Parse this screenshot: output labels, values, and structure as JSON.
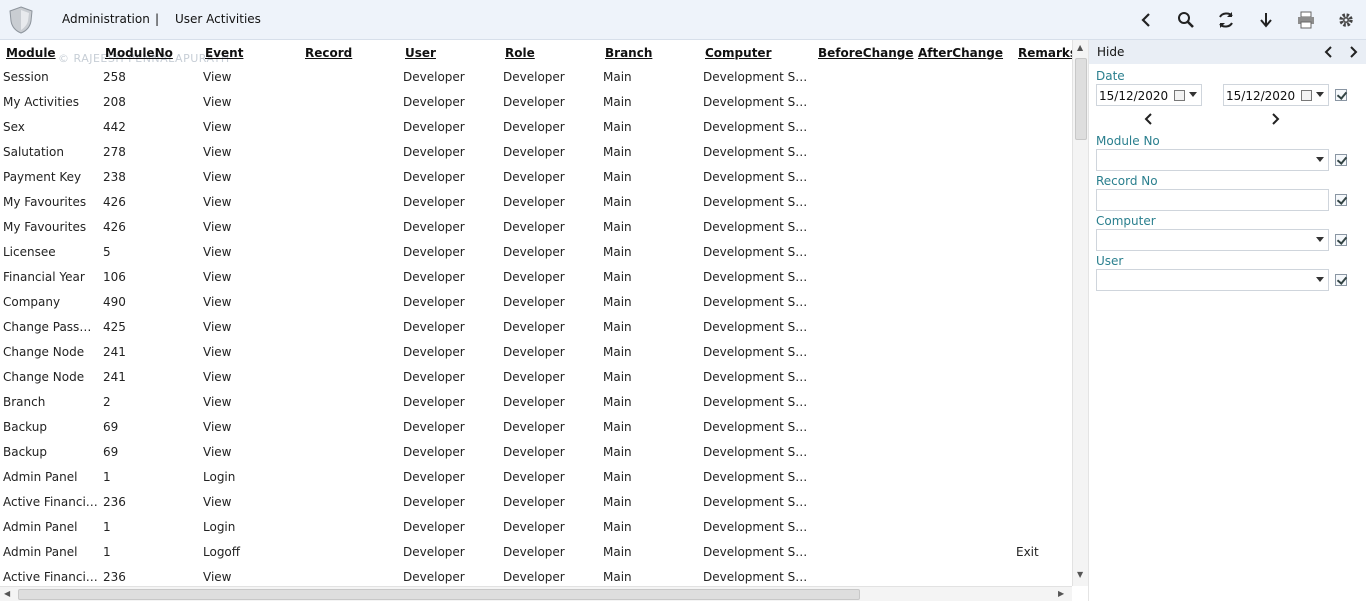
{
  "header": {
    "breadcrumb": [
      "Administration",
      "|",
      "User Activities"
    ],
    "toolbar": [
      "back-icon",
      "search-icon",
      "refresh-icon",
      "download-icon",
      "print-icon",
      "gear-icon"
    ]
  },
  "watermark": "© RAJEESH PENNALAPURATH",
  "grid": {
    "columns": [
      "Module",
      "ModuleNo",
      "Event",
      "Record",
      "User",
      "Role",
      "Branch",
      "Computer",
      "BeforeChange",
      "AfterChange",
      "Remarks"
    ],
    "rows": [
      [
        "Session",
        "258",
        "View",
        "",
        "Developer",
        "Developer",
        "Main",
        "Development Server",
        "",
        "",
        ""
      ],
      [
        "My Activities",
        "208",
        "View",
        "",
        "Developer",
        "Developer",
        "Main",
        "Development Server",
        "",
        "",
        ""
      ],
      [
        "Sex",
        "442",
        "View",
        "",
        "Developer",
        "Developer",
        "Main",
        "Development Server",
        "",
        "",
        ""
      ],
      [
        "Salutation",
        "278",
        "View",
        "",
        "Developer",
        "Developer",
        "Main",
        "Development Server",
        "",
        "",
        ""
      ],
      [
        "Payment Key",
        "238",
        "View",
        "",
        "Developer",
        "Developer",
        "Main",
        "Development Server",
        "",
        "",
        ""
      ],
      [
        "My Favourites",
        "426",
        "View",
        "",
        "Developer",
        "Developer",
        "Main",
        "Development Server",
        "",
        "",
        ""
      ],
      [
        "My Favourites",
        "426",
        "View",
        "",
        "Developer",
        "Developer",
        "Main",
        "Development Server",
        "",
        "",
        ""
      ],
      [
        "Licensee",
        "5",
        "View",
        "",
        "Developer",
        "Developer",
        "Main",
        "Development Server",
        "",
        "",
        ""
      ],
      [
        "Financial Year",
        "106",
        "View",
        "",
        "Developer",
        "Developer",
        "Main",
        "Development Server",
        "",
        "",
        ""
      ],
      [
        "Company",
        "490",
        "View",
        "",
        "Developer",
        "Developer",
        "Main",
        "Development Server",
        "",
        "",
        ""
      ],
      [
        "Change Passwo...",
        "425",
        "View",
        "",
        "Developer",
        "Developer",
        "Main",
        "Development Server",
        "",
        "",
        ""
      ],
      [
        "Change Node",
        "241",
        "View",
        "",
        "Developer",
        "Developer",
        "Main",
        "Development Server",
        "",
        "",
        ""
      ],
      [
        "Change Node",
        "241",
        "View",
        "",
        "Developer",
        "Developer",
        "Main",
        "Development Server",
        "",
        "",
        ""
      ],
      [
        "Branch",
        "2",
        "View",
        "",
        "Developer",
        "Developer",
        "Main",
        "Development Server",
        "",
        "",
        ""
      ],
      [
        "Backup",
        "69",
        "View",
        "",
        "Developer",
        "Developer",
        "Main",
        "Development Server",
        "",
        "",
        ""
      ],
      [
        "Backup",
        "69",
        "View",
        "",
        "Developer",
        "Developer",
        "Main",
        "Development Server",
        "",
        "",
        ""
      ],
      [
        "Admin Panel",
        "1",
        "Login",
        "",
        "Developer",
        "Developer",
        "Main",
        "Development Server",
        "",
        "",
        ""
      ],
      [
        "Active Financial...",
        "236",
        "View",
        "",
        "Developer",
        "Developer",
        "Main",
        "Development Server",
        "",
        "",
        ""
      ],
      [
        "Admin Panel",
        "1",
        "Login",
        "",
        "Developer",
        "Developer",
        "Main",
        "Development Server",
        "",
        "",
        ""
      ],
      [
        "Admin Panel",
        "1",
        "Logoff",
        "",
        "Developer",
        "Developer",
        "Main",
        "Development Server",
        "",
        "",
        "Exit"
      ],
      [
        "Active Financial...",
        "236",
        "View",
        "",
        "Developer",
        "Developer",
        "Main",
        "Development Server",
        "",
        "",
        ""
      ]
    ]
  },
  "filter_panel": {
    "hide_label": "Hide",
    "date_label": "Date",
    "date_from": "15/12/2020",
    "date_to": "15/12/2020",
    "module_no_label": "Module No",
    "module_no_value": "",
    "record_no_label": "Record No",
    "record_no_value": "",
    "computer_label": "Computer",
    "computer_value": "",
    "user_label": "User",
    "user_value": ""
  }
}
